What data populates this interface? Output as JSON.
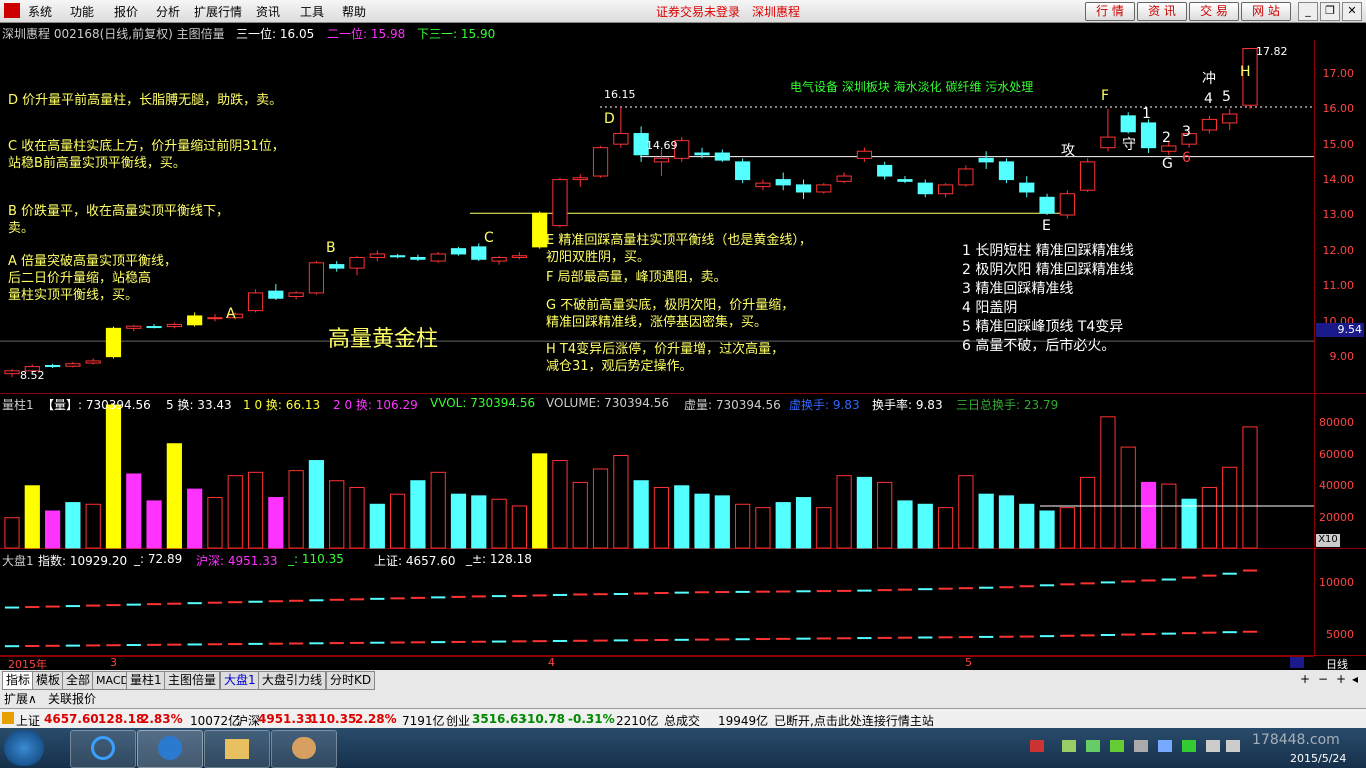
{
  "menu": {
    "items": [
      "系统",
      "功能",
      "报价",
      "分析",
      "扩展行情",
      "资讯",
      "工具",
      "帮助"
    ],
    "center_status": "证券交易未登录",
    "center_stock": "深圳惠程",
    "buttons": [
      "行 情",
      "资 讯",
      "交 易",
      "网 站"
    ]
  },
  "chart_header": {
    "stock": "深圳惠程 002168(日线,前复权) 主图倍量",
    "line1": "三一位: 16.05",
    "line2": "二一位: 15.98",
    "line3": "下三一: 15.90"
  },
  "price_axis": [
    "17.00",
    "16.00",
    "15.00",
    "14.00",
    "13.00",
    "12.00",
    "11.00",
    "10.00",
    "9.54",
    "9.00"
  ],
  "price_marks": {
    "high": "16.15",
    "mid": "14.69",
    "peak": "17.82",
    "low": "8.52"
  },
  "sector_tags": "电气设备  深圳板块  海水淡化 碳纤维 污水处理",
  "annotations_left": {
    "d": "D 价升量平前高量柱，长脂膊无腿，助跌，卖。",
    "c1": "C 收在高量柱实底上方，价升量缩过前阴31位，",
    "c2": "  站稳B前高量实顶平衡线，买。",
    "b1": "B 价跌量平，收在高量实顶平衡线下，",
    "b2": "  卖。",
    "a1": "A 倍量突破高量实顶平衡线，",
    "a2": "  后二日价升量缩，站稳高",
    "a3": "  量柱实顶平衡线，买。",
    "gold": "高量黄金柱"
  },
  "annotations_mid": {
    "e1": "E 精准回踩高量柱实顶平衡线（也是黄金线），",
    "e2": "  初阳双胜阴，买。",
    "f": "F 局部最高量，峰顶遇阻，卖。",
    "g1": "G 不破前高量实底，极阴次阳，价升量缩，",
    "g2": "  精准回踩精准线，涨停基因密集，买。",
    "h1": "H  T4变异后涨停，价升量增，过次高量，",
    "h2": "  减仓31，观后势定操作。"
  },
  "annotations_right": [
    "1 长阴短柱 精准回踩精准线",
    "2 极阴次阳 精准回踩精准线",
    "3 精准回踩精准线",
    "4 阳盖阴",
    "5 精准回踩峰顶线 T4变异",
    "6 高量不破，后市必火。"
  ],
  "chart_letters": {
    "A": "A",
    "B": "B",
    "C": "C",
    "D": "D",
    "E": "E",
    "F": "F",
    "G": "G",
    "H": "H",
    "attack": "攻",
    "guard": "守",
    "rush": "冲",
    "n1": "1",
    "n2": "2",
    "n3": "3",
    "n4": "4",
    "n5": "5",
    "n6": "6"
  },
  "volume_header": {
    "title": "量柱1",
    "vol": "【量】: 730394.56",
    "h5": "5 换: 33.43",
    "h10": "1 0 换: 66.13",
    "h20": "2 0 换: 106.29",
    "vvol": "VVOL: 730394.56",
    "volume": "VOLUME: 730394.56",
    "xuliang": "虚量: 730394.56",
    "xuhuan": "虚换手: 9.83",
    "huanshou": "换手率: 9.83",
    "sanri": "三日总换手: 23.79"
  },
  "volume_axis": [
    "80000",
    "60000",
    "40000",
    "20000"
  ],
  "volume_unit": "X10",
  "dapan_header": {
    "title": "大盘1",
    "index": "指数: 10929.20",
    "v1": "_: 72.89",
    "hushen": "沪深: 4951.33",
    "v2": "_: 110.35",
    "shangzheng": "上证: 4657.60",
    "v3": "_±: 128.18"
  },
  "dapan_axis": [
    "10000",
    "5000"
  ],
  "date_axis": {
    "year": "2015年",
    "m3": "3",
    "m4": "4",
    "m5": "5",
    "period": "日线"
  },
  "tabs": [
    "指标",
    "模板",
    "全部",
    "MACD",
    "量柱1",
    "主图倍量",
    "大盘1",
    "大盘引力线",
    "分时KD"
  ],
  "subtabs": [
    "扩展∧",
    "关联报价"
  ],
  "status": {
    "sh_label": "上证",
    "sh_val": "4657.60",
    "sh_chg": "128.18",
    "sh_pct": "2.83%",
    "sh_amt": "10072亿",
    "hs_label": "沪深",
    "hs_val": "4951.33",
    "hs_chg": "110.35",
    "hs_pct": "2.28%",
    "hs_amt": "7191亿",
    "cy_label": "创业",
    "cy_val": "3516.63",
    "cy_chg": "-10.78",
    "cy_pct": "-0.31%",
    "cy_amt": "2210亿",
    "total_label": "总成交",
    "total_val": "19949亿",
    "msg": "已断开,点击此处连接行情主站"
  },
  "taskbar": {
    "date": "2015/5/24",
    "watermark": "178448.com"
  },
  "colors": {
    "up": "#ff3333",
    "down": "#54ffff",
    "gold": "#ffff00",
    "magenta": "#ff33ff",
    "grid": "#8b0000"
  },
  "chart_data": {
    "type": "candlestick",
    "candles": [
      [
        8.62,
        8.75,
        8.52,
        8.7,
        "u"
      ],
      [
        8.7,
        8.88,
        8.66,
        8.82,
        "u"
      ],
      [
        8.85,
        8.9,
        8.78,
        8.82,
        "d"
      ],
      [
        8.83,
        8.95,
        8.8,
        8.9,
        "u"
      ],
      [
        8.92,
        9.05,
        8.88,
        8.98,
        "u"
      ],
      [
        9.1,
        9.95,
        9.05,
        9.9,
        "g"
      ],
      [
        9.9,
        10.0,
        9.82,
        9.96,
        "u"
      ],
      [
        9.95,
        10.02,
        9.9,
        9.94,
        "d"
      ],
      [
        9.95,
        10.06,
        9.9,
        10.01,
        "u"
      ],
      [
        10.0,
        10.35,
        9.95,
        10.25,
        "g"
      ],
      [
        10.2,
        10.3,
        10.1,
        10.18,
        "u"
      ],
      [
        10.2,
        10.35,
        10.15,
        10.3,
        "u"
      ],
      [
        10.4,
        11.0,
        10.35,
        10.9,
        "u"
      ],
      [
        10.95,
        11.15,
        10.7,
        10.75,
        "d"
      ],
      [
        10.8,
        10.95,
        10.72,
        10.9,
        "u"
      ],
      [
        10.9,
        11.8,
        10.85,
        11.75,
        "u"
      ],
      [
        11.7,
        11.8,
        11.5,
        11.6,
        "d"
      ],
      [
        11.6,
        11.95,
        11.4,
        11.9,
        "u"
      ],
      [
        11.9,
        12.1,
        11.8,
        12.0,
        "u"
      ],
      [
        11.95,
        12.0,
        11.88,
        11.92,
        "d"
      ],
      [
        11.9,
        11.98,
        11.8,
        11.85,
        "d"
      ],
      [
        11.8,
        12.05,
        11.75,
        12.0,
        "u"
      ],
      [
        12.0,
        12.2,
        11.95,
        12.15,
        "d"
      ],
      [
        12.2,
        12.3,
        11.8,
        11.85,
        "d"
      ],
      [
        11.8,
        11.95,
        11.7,
        11.9,
        "u"
      ],
      [
        11.9,
        12.05,
        11.85,
        11.95,
        "u"
      ],
      [
        12.2,
        13.2,
        12.15,
        13.15,
        "g"
      ],
      [
        12.8,
        14.15,
        12.75,
        14.1,
        "u"
      ],
      [
        14.1,
        14.25,
        13.9,
        14.15,
        "u"
      ],
      [
        14.2,
        15.05,
        14.15,
        15.0,
        "u"
      ],
      [
        15.1,
        16.15,
        15.0,
        15.4,
        "u"
      ],
      [
        15.4,
        15.6,
        14.6,
        14.8,
        "d"
      ],
      [
        14.7,
        14.95,
        14.2,
        14.6,
        "u"
      ],
      [
        14.7,
        15.3,
        14.6,
        15.2,
        "u"
      ],
      [
        14.8,
        15.0,
        14.7,
        14.85,
        "d"
      ],
      [
        14.85,
        14.95,
        14.6,
        14.65,
        "d"
      ],
      [
        14.6,
        14.7,
        14.0,
        14.1,
        "d"
      ],
      [
        13.9,
        14.1,
        13.8,
        14.0,
        "u"
      ],
      [
        14.1,
        14.3,
        13.8,
        13.95,
        "d"
      ],
      [
        13.95,
        14.1,
        13.55,
        13.75,
        "d"
      ],
      [
        13.75,
        14.0,
        13.7,
        13.95,
        "u"
      ],
      [
        14.05,
        14.3,
        14.0,
        14.2,
        "u"
      ],
      [
        14.7,
        15.0,
        14.6,
        14.9,
        "u"
      ],
      [
        14.5,
        14.6,
        14.1,
        14.2,
        "d"
      ],
      [
        14.1,
        14.2,
        14.0,
        14.05,
        "d"
      ],
      [
        14.0,
        14.1,
        13.6,
        13.7,
        "d"
      ],
      [
        13.7,
        14.0,
        13.6,
        13.95,
        "u"
      ],
      [
        13.95,
        14.5,
        13.9,
        14.4,
        "u"
      ],
      [
        14.7,
        14.9,
        14.4,
        14.6,
        "d"
      ],
      [
        14.6,
        14.7,
        14.0,
        14.1,
        "d"
      ],
      [
        14.0,
        14.2,
        13.6,
        13.75,
        "d"
      ],
      [
        13.6,
        13.7,
        13.1,
        13.15,
        "d"
      ],
      [
        13.1,
        13.8,
        13.0,
        13.7,
        "u"
      ],
      [
        13.8,
        14.7,
        13.75,
        14.6,
        "u"
      ],
      [
        15.0,
        16.1,
        14.9,
        15.3,
        "u"
      ],
      [
        15.9,
        16.0,
        15.4,
        15.45,
        "d"
      ],
      [
        15.7,
        15.8,
        14.85,
        15.0,
        "d"
      ],
      [
        14.9,
        15.2,
        14.8,
        15.05,
        "u"
      ],
      [
        15.1,
        15.6,
        15.0,
        15.4,
        "u"
      ],
      [
        15.5,
        15.9,
        15.4,
        15.8,
        "u"
      ],
      [
        15.7,
        16.1,
        15.5,
        15.95,
        "u"
      ],
      [
        16.2,
        17.82,
        16.1,
        17.8,
        "u"
      ]
    ],
    "volumes": [
      [
        18000,
        "u"
      ],
      [
        37000,
        "g"
      ],
      [
        22000,
        "m"
      ],
      [
        27000,
        "d"
      ],
      [
        26000,
        "u"
      ],
      [
        85000,
        "g"
      ],
      [
        44000,
        "m"
      ],
      [
        28000,
        "m"
      ],
      [
        62000,
        "g"
      ],
      [
        35000,
        "m"
      ],
      [
        30000,
        "u"
      ],
      [
        43000,
        "u"
      ],
      [
        45000,
        "u"
      ],
      [
        30000,
        "m"
      ],
      [
        46000,
        "u"
      ],
      [
        52000,
        "d"
      ],
      [
        40000,
        "u"
      ],
      [
        36000,
        "u"
      ],
      [
        26000,
        "d"
      ],
      [
        32000,
        "u"
      ],
      [
        40000,
        "d"
      ],
      [
        45000,
        "u"
      ],
      [
        32000,
        "d"
      ],
      [
        31000,
        "d"
      ],
      [
        29000,
        "u"
      ],
      [
        25000,
        "u"
      ],
      [
        56000,
        "g"
      ],
      [
        52000,
        "u"
      ],
      [
        39000,
        "u"
      ],
      [
        47000,
        "u"
      ],
      [
        55000,
        "u"
      ],
      [
        40000,
        "d"
      ],
      [
        36000,
        "u"
      ],
      [
        37000,
        "d"
      ],
      [
        32000,
        "d"
      ],
      [
        31000,
        "d"
      ],
      [
        26000,
        "u"
      ],
      [
        24000,
        "u"
      ],
      [
        27000,
        "d"
      ],
      [
        30000,
        "d"
      ],
      [
        24000,
        "u"
      ],
      [
        43000,
        "u"
      ],
      [
        42000,
        "d"
      ],
      [
        39000,
        "u"
      ],
      [
        28000,
        "d"
      ],
      [
        26000,
        "d"
      ],
      [
        24000,
        "u"
      ],
      [
        43000,
        "u"
      ],
      [
        32000,
        "d"
      ],
      [
        31000,
        "d"
      ],
      [
        26000,
        "d"
      ],
      [
        22000,
        "d"
      ],
      [
        24000,
        "u"
      ],
      [
        42000,
        "u"
      ],
      [
        78000,
        "u"
      ],
      [
        60000,
        "u"
      ],
      [
        39000,
        "m"
      ],
      [
        38000,
        "u"
      ],
      [
        29000,
        "d"
      ],
      [
        36000,
        "u"
      ],
      [
        48000,
        "u"
      ],
      [
        72000,
        "u"
      ]
    ],
    "dapan_upper": [
      7100,
      7150,
      7200,
      7250,
      7300,
      7350,
      7400,
      7450,
      7500,
      7550,
      7600,
      7650,
      7700,
      7750,
      7800,
      7850,
      7900,
      7950,
      8000,
      8050,
      8100,
      8150,
      8200,
      8250,
      8280,
      8300,
      8350,
      8400,
      8450,
      8480,
      8500,
      8550,
      8600,
      8640,
      8680,
      8700,
      8720,
      8740,
      8760,
      8780,
      8800,
      8820,
      8850,
      8900,
      8950,
      9000,
      9050,
      9100,
      9150,
      9200,
      9300,
      9400,
      9500,
      9600,
      9700,
      9800,
      9900,
      10000,
      10200,
      10400,
      10600,
      10929
    ],
    "dapan_lower": [
      3100,
      3120,
      3140,
      3160,
      3180,
      3200,
      3220,
      3240,
      3260,
      3280,
      3300,
      3320,
      3340,
      3360,
      3380,
      3400,
      3420,
      3440,
      3460,
      3480,
      3500,
      3520,
      3540,
      3560,
      3580,
      3600,
      3620,
      3640,
      3660,
      3680,
      3700,
      3720,
      3740,
      3760,
      3780,
      3800,
      3820,
      3840,
      3860,
      3880,
      3900,
      3920,
      3940,
      3960,
      3980,
      4000,
      4020,
      4040,
      4060,
      4080,
      4100,
      4140,
      4180,
      4220,
      4260,
      4300,
      4350,
      4400,
      4450,
      4500,
      4550,
      4600
    ],
    "price_ylim": [
      8.3,
      17.9
    ],
    "volume_ylim": [
      0,
      88000
    ],
    "dapan_ylim": [
      2500,
      11500
    ]
  }
}
